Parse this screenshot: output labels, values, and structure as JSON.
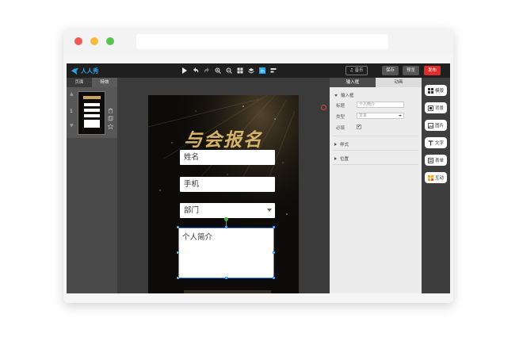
{
  "app": {
    "logo_text": "人人秀",
    "music_label": "♫ 音乐",
    "save_label": "保存",
    "preview_label": "预览",
    "publish_label": "发布"
  },
  "toolbar_icons": [
    "play-icon",
    "undo-icon",
    "redo-icon",
    "zoom-in-icon",
    "zoom-out-icon",
    "grid-icon",
    "layers-icon",
    "brand-icon",
    "align-icon"
  ],
  "left_panel": {
    "tabs": [
      "页面",
      "特效"
    ],
    "page_number": "1"
  },
  "poster": {
    "title": "与会报名",
    "fields": {
      "name": "姓名",
      "phone": "手机",
      "department": "部门",
      "intro": "个人简介"
    }
  },
  "properties": {
    "tabs": [
      "输入框",
      "动画"
    ],
    "section_input": "输入框",
    "label_title": "标题",
    "title_value": "个人简介",
    "label_type": "类型",
    "type_value": "文本",
    "label_required": "必填",
    "required_checked": true,
    "section_style": "样式",
    "section_position": "位置"
  },
  "widgets": [
    {
      "label": "模版",
      "icon": "template-icon"
    },
    {
      "label": "背景",
      "icon": "background-icon"
    },
    {
      "label": "图片",
      "icon": "image-icon"
    },
    {
      "label": "文字",
      "icon": "text-icon"
    },
    {
      "label": "表单",
      "icon": "form-icon"
    },
    {
      "label": "互动",
      "icon": "interaction-icon"
    }
  ],
  "colors": {
    "publish": "#e32b2b",
    "accent": "#2aa6e8",
    "gold": "#d6b36a",
    "selection": "#3a8ee6"
  }
}
